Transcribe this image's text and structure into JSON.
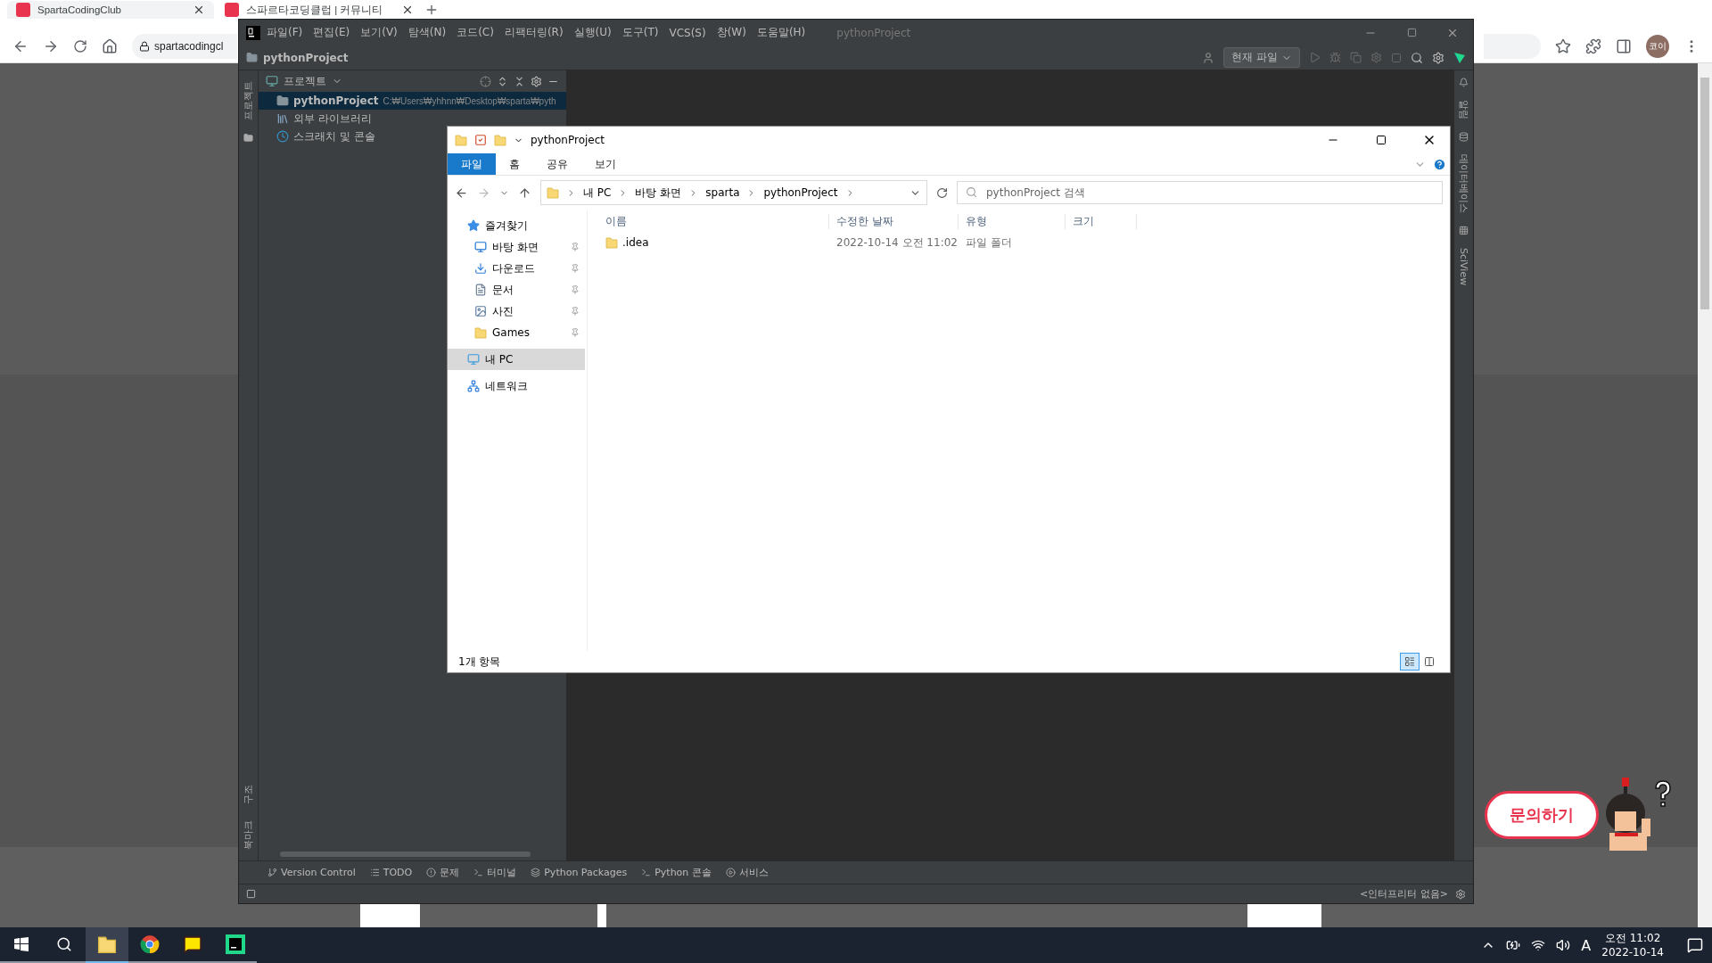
{
  "browser": {
    "tabs": [
      {
        "title": "SpartaCodingClub",
        "selected": false
      },
      {
        "title": "스파르타코딩클럽 | 커뮤니티",
        "selected": true
      }
    ],
    "url": "spartacodingcl",
    "profile": "코이"
  },
  "ide": {
    "title": "pythonProject",
    "menu": [
      "파일(F)",
      "편집(E)",
      "보기(V)",
      "탐색(N)",
      "코드(C)",
      "리팩터링(R)",
      "실행(U)",
      "도구(T)",
      "VCS(S)",
      "창(W)",
      "도움말(H)"
    ],
    "breadcrumb": "pythonProject",
    "run_config": "현재 파일",
    "left_stripe_top": [
      "프로젝트"
    ],
    "left_stripe_bottom": [
      "구조",
      "북마크"
    ],
    "right_stripe": [
      "알림",
      "데이터베이스",
      "SciView"
    ],
    "project_panel": {
      "title": "프로젝트",
      "tree": [
        {
          "kind": "project",
          "label": "pythonProject",
          "path": "C:₩Users₩yhhnn₩Desktop₩sparta₩pyth",
          "selected": true
        },
        {
          "kind": "library",
          "label": "외부 라이브러리",
          "selected": false
        },
        {
          "kind": "scratch",
          "label": "스크래치 및 콘솔",
          "selected": false
        }
      ]
    },
    "tool_tabs": [
      {
        "kind": "vcs",
        "label": "Version Control"
      },
      {
        "kind": "todo",
        "label": "TODO"
      },
      {
        "kind": "problems",
        "label": "문제"
      },
      {
        "kind": "terminal",
        "label": "터미널"
      },
      {
        "kind": "packages",
        "label": "Python Packages"
      },
      {
        "kind": "console",
        "label": "Python 콘솔"
      },
      {
        "kind": "services",
        "label": "서비스"
      }
    ],
    "status": "<인터프리터 없음>"
  },
  "explorer": {
    "title": "pythonProject",
    "ribbon_tabs": [
      {
        "label": "파일",
        "selected": true
      },
      {
        "label": "홈",
        "selected": false
      },
      {
        "label": "공유",
        "selected": false
      },
      {
        "label": "보기",
        "selected": false
      }
    ],
    "path": [
      "내 PC",
      "바탕 화면",
      "sparta",
      "pythonProject"
    ],
    "search": {
      "placeholder": "pythonProject 검색"
    },
    "nav": [
      {
        "kind": "header",
        "label": "즐겨찾기",
        "selected": false
      },
      {
        "kind": "pinned",
        "label": "바탕 화면",
        "selected": false
      },
      {
        "kind": "pinned",
        "label": "다운로드",
        "selected": false
      },
      {
        "kind": "pinned",
        "label": "문서",
        "selected": false
      },
      {
        "kind": "pinned",
        "label": "사진",
        "selected": false
      },
      {
        "kind": "pinned",
        "label": "Games",
        "selected": false
      },
      {
        "kind": "root",
        "label": "내 PC",
        "selected": true
      },
      {
        "kind": "root",
        "label": "네트워크",
        "selected": false
      }
    ],
    "columns": [
      "이름",
      "수정한 날짜",
      "유형",
      "크기"
    ],
    "rows": [
      {
        "name": ".idea",
        "modified": "2022-10-14 오전 11:02",
        "type": "파일 폴더"
      }
    ],
    "status": "1개 항목",
    "view_buttons": [
      {
        "kind": "details",
        "selected": true
      },
      {
        "kind": "tiles",
        "selected": false
      }
    ]
  },
  "chat_button": "문의하기",
  "taskbar": {
    "apps": [
      {
        "kind": "explorer",
        "selected": true
      },
      {
        "kind": "chrome",
        "selected": false
      },
      {
        "kind": "kakaotalk",
        "selected": false
      },
      {
        "kind": "pycharm",
        "selected": false
      }
    ],
    "ime": "A",
    "time": "오전 11:02",
    "date": "2022-10-14"
  }
}
